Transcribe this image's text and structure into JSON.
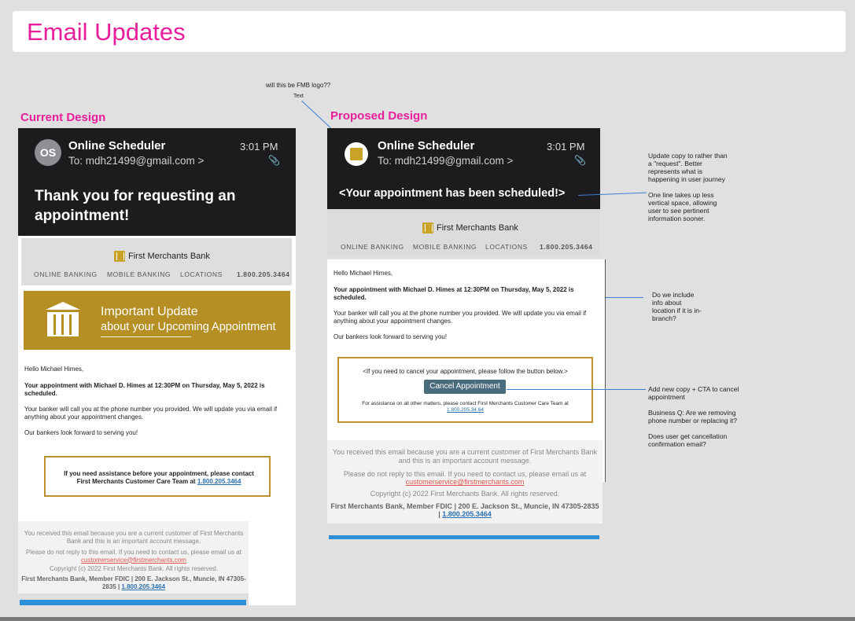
{
  "page": {
    "title": "Email Updates"
  },
  "labels": {
    "current": "Current Design",
    "proposed": "Proposed Design"
  },
  "colors": {
    "accent": "#e91e9c",
    "gold": "#b58e24",
    "dark": "#1c1c1e",
    "button": "#4a6b7d"
  },
  "top_comment": {
    "line1": "will this be FMB logo??",
    "line2": "Text"
  },
  "current": {
    "avatar": "OS",
    "sender": "Online Scheduler",
    "time": "3:01 PM",
    "to": "To: mdh21499@gmail.com >",
    "headline": "Thank you for requesting an appointment!",
    "brand": "First Merchants Bank",
    "nav": [
      "ONLINE BANKING",
      "MOBILE BANKING",
      "LOCATIONS",
      "1.800.205.3464"
    ],
    "banner_line1": "Important Update",
    "banner_line2": "about your Upcoming Appointment",
    "greeting": "Hello Michael Himes,",
    "appointment": "Your appointment with Michael D. Himes at 12:30PM on Thursday, May 5, 2022 is scheduled.",
    "banker": "Your banker will call you at the phone number you provided. We will update you via email if anything about your appointment changes.",
    "forward": "Our bankers look forward to serving you!",
    "box_text": "If you need assistance before your appointment, please contact First Merchants Customer Care Team at",
    "box_phone": "1.800.205.3464",
    "foot1": "You received this email because you are a current customer of First Merchants Bank and this is an important account message.",
    "foot2": "Please do not reply to this email. If you need to contact us, please email us at",
    "foot_email": "customerservice@firstmerchants.com",
    "foot3": "Copyright (c) 2022 First Merchants Bank. All rights reserved.",
    "foot4": "First Merchants Bank, Member FDIC | 200 E. Jackson St., Muncie, IN 47305-2835 |",
    "foot_phone": "1.800.205.3464"
  },
  "proposed": {
    "sender": "Online Scheduler",
    "time": "3:01 PM",
    "to": "To: mdh21499@gmail.com >",
    "headline": "<Your appointment has been scheduled!>",
    "brand": "First Merchants Bank",
    "nav": [
      "ONLINE BANKING",
      "MOBILE BANKING",
      "LOCATIONS",
      "1.800.205.3464"
    ],
    "greeting": "Hello Michael Himes,",
    "appointment": "Your appointment with Michael D. Himes at 12:30PM on Thursday, May 5, 2022 is scheduled.",
    "banker": "Your banker will call you at the phone number you provided. We will update you via email if anything about your appointment changes.",
    "forward": "Our bankers look forward to serving you!",
    "cancel_text": "<If you need to cancel your appointment, please follow the button below.>",
    "cancel_button": "Cancel Appointment",
    "assist_text": "For assistance on all other matters, please contact First Merchants Customer Care Team at",
    "assist_phone": "1.800.205.34 64",
    "foot1": "You received this email because you are a current customer of First Merchants Bank and this is an important account message.",
    "foot2": "Please do not reply to this email. If you need to contact us, please email us at",
    "foot_email": "customerservice@firstmerchants.com",
    "foot3": "Copyright (c) 2022 First Merchants Bank. All rights reserved.",
    "foot4": "First Merchants Bank, Member FDIC | 200 E. Jackson St., Muncie, IN 47305-2835 |",
    "foot_phone": "1.800.205.3464"
  },
  "notes": {
    "update_copy": "Update copy to rather than a \"request\". Better represents what is happening in user journey",
    "one_line": "One line takes up less vertical space, allowing user to see pertinent information sooner.",
    "location": "Do we include info about location if it is in-branch?",
    "add_cta": "Add new copy + CTA to cancel appointment",
    "business_q": "Business Q: Are we removing phone number or replacing it?",
    "confirmation": "Does user get cancellation confirmation email?"
  }
}
